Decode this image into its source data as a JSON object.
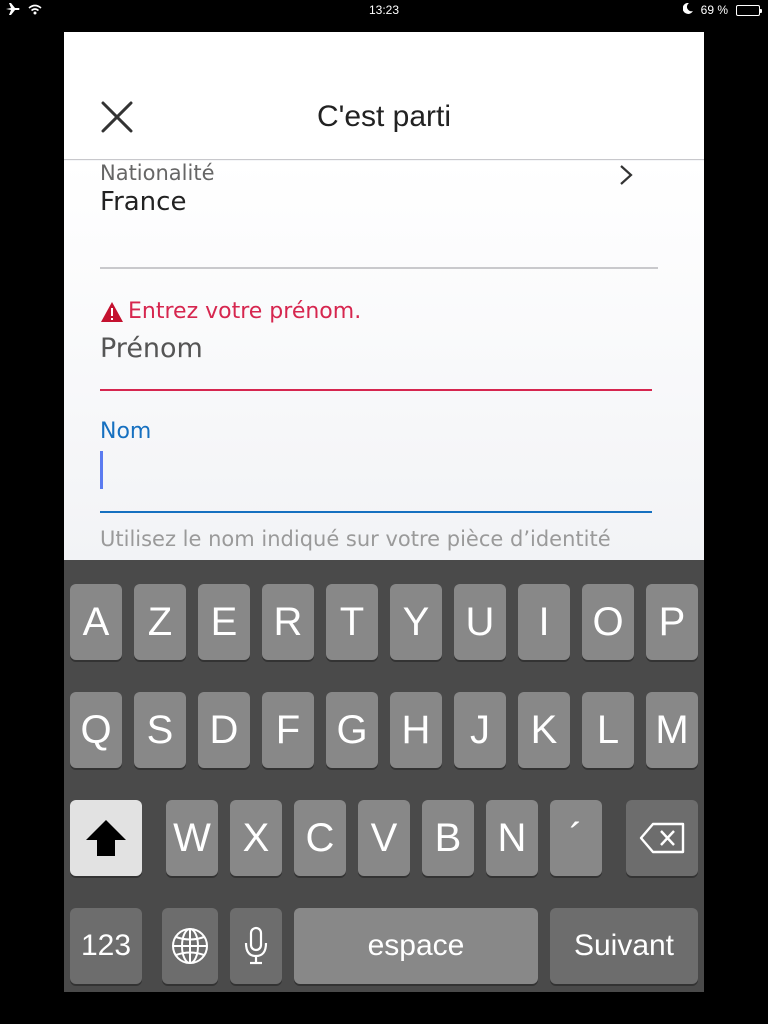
{
  "status_bar": {
    "time": "13:23",
    "battery_text": "69 %",
    "battery_level": 0.69,
    "left_icons": [
      "airplane-icon",
      "wifi-icon"
    ],
    "right_icons": [
      "moon-icon",
      "battery-icon"
    ]
  },
  "header": {
    "title": "C'est parti",
    "close_icon": "close-icon"
  },
  "form": {
    "nationality": {
      "label": "Nationalité",
      "value": "France",
      "icon": "chevron-right-icon"
    },
    "first_name": {
      "error": "Entrez votre prénom.",
      "placeholder": "Prénom",
      "error_color": "#d6264f"
    },
    "last_name": {
      "label": "Nom",
      "value": "",
      "accent_color": "#1670c0"
    },
    "helper": "Utilisez le nom indiqué sur votre pièce d’identité officielle."
  },
  "keyboard": {
    "row1": [
      "A",
      "Z",
      "E",
      "R",
      "T",
      "Y",
      "U",
      "I",
      "O",
      "P"
    ],
    "row2": [
      "Q",
      "S",
      "D",
      "F",
      "G",
      "H",
      "J",
      "K",
      "L",
      "M"
    ],
    "row3": [
      "W",
      "X",
      "C",
      "V",
      "B",
      "N",
      "´"
    ],
    "numbers_label": "123",
    "space_label": "espace",
    "next_label": "Suivant",
    "icons": [
      "shift-icon",
      "backspace-icon",
      "globe-icon",
      "microphone-icon"
    ]
  }
}
